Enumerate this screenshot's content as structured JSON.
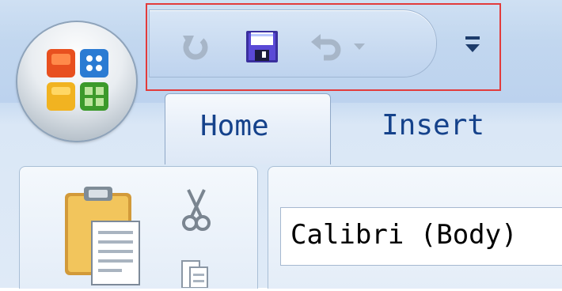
{
  "quick_access_toolbar": {
    "items": [
      {
        "icon": "redo-icon",
        "enabled": false
      },
      {
        "icon": "save-icon",
        "enabled": true
      },
      {
        "icon": "undo-icon",
        "enabled": false
      },
      {
        "icon": "undo-dropdown-arrow-icon",
        "enabled": false
      },
      {
        "icon": "customize-toolbar-icon",
        "enabled": true
      }
    ]
  },
  "tabs": [
    {
      "label": "Home",
      "active": true
    },
    {
      "label": "Insert",
      "active": false
    }
  ],
  "font_group": {
    "font_name": "Calibri (Body)"
  },
  "colors": {
    "highlight_border": "#e23b3b",
    "tab_text": "#15428b"
  }
}
